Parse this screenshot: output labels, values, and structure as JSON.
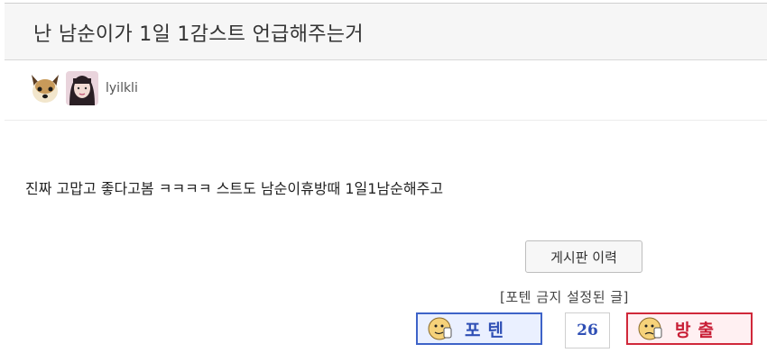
{
  "post": {
    "title": "난 남순이가 1일 1감스트 언급해주는거",
    "author": "lyilkli",
    "body": "진짜 고맙고 좋다고봄 ㅋㅋㅋㅋ 스트도 남순이휴방때 1일1남순해주고"
  },
  "actions": {
    "history_label": "게시판 이력",
    "notice": "[포텐 금지 설정된 글]",
    "upvote_label": "포텐",
    "downvote_label": "방출",
    "vote_count": "26"
  },
  "colors": {
    "upvote": "#3e63c8",
    "downvote": "#d0283a"
  }
}
